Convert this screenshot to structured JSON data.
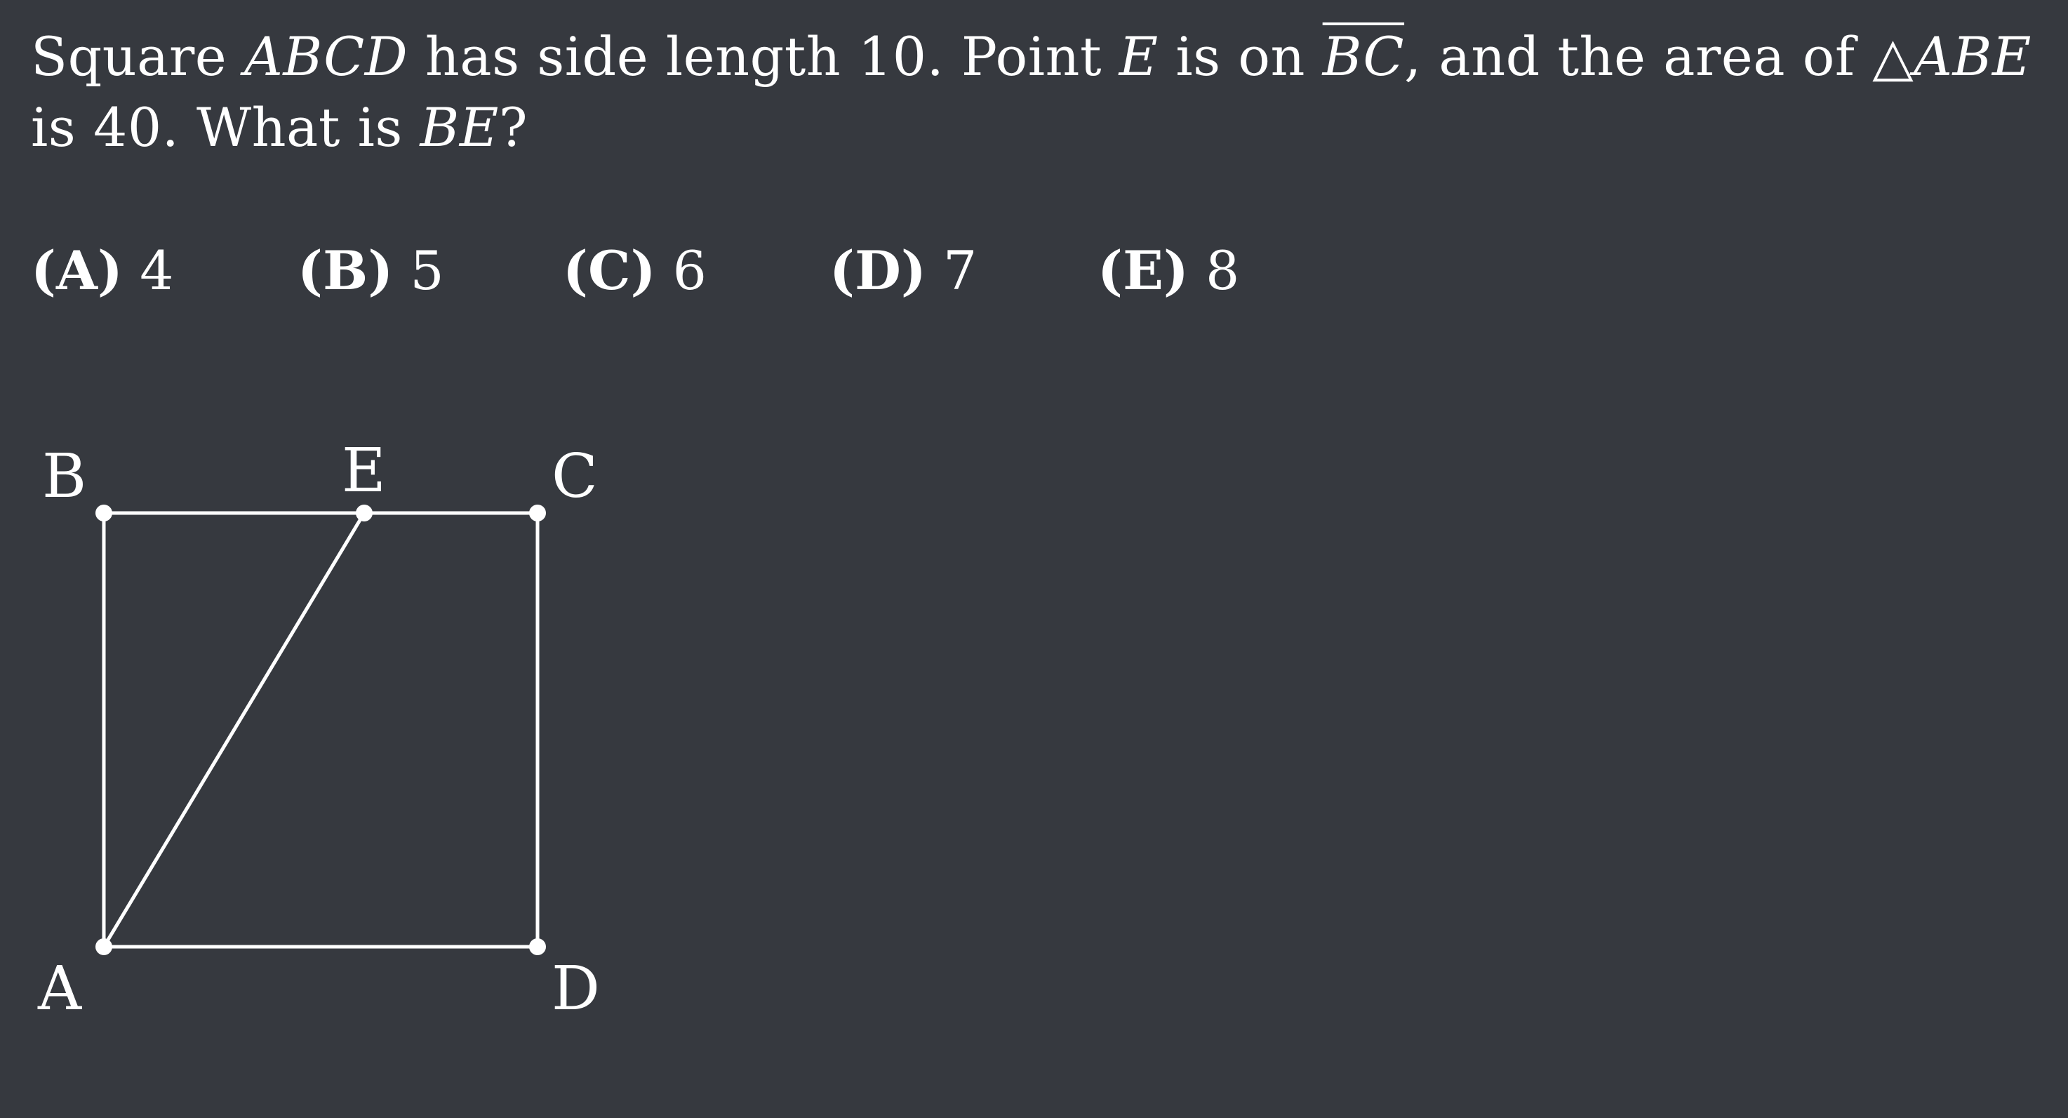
{
  "problem": {
    "line1": {
      "t1": "Square ",
      "m1": "ABCD",
      "t2": " has side length 10. Point ",
      "m2": "E",
      "t3": " is on ",
      "m3": "BC",
      "t4": ", and the area of △",
      "m4": "ABE"
    },
    "line2": {
      "t1": "is 40. What is ",
      "m1": "BE",
      "t2": "?"
    }
  },
  "choices": [
    {
      "letter": "(A)",
      "value": "4"
    },
    {
      "letter": "(B)",
      "value": "5"
    },
    {
      "letter": "(C)",
      "value": "6"
    },
    {
      "letter": "(D)",
      "value": "7"
    },
    {
      "letter": "(E)",
      "value": "8"
    }
  ],
  "figure": {
    "points": [
      {
        "label": "B"
      },
      {
        "label": "E"
      },
      {
        "label": "C"
      },
      {
        "label": "A"
      },
      {
        "label": "D"
      }
    ]
  }
}
